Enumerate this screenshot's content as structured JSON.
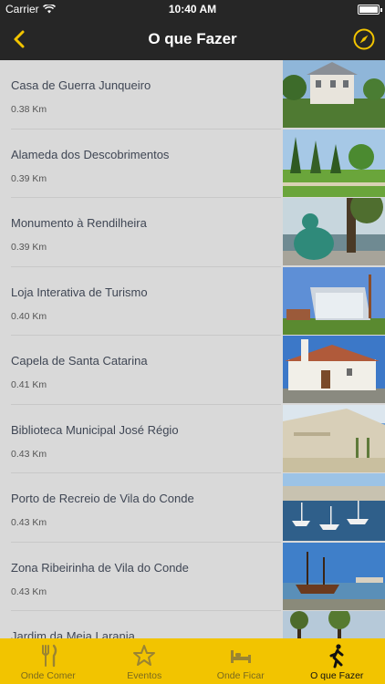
{
  "status": {
    "carrier": "Carrier",
    "time": "10:40 AM"
  },
  "nav": {
    "title": "O que Fazer",
    "back_icon": "chevron-left-icon",
    "right_icon": "compass-icon",
    "accent": "#f2c400"
  },
  "items": [
    {
      "name": "Casa de Guerra Junqueiro",
      "distance": "0.38 Km"
    },
    {
      "name": "Alameda dos Descobrimentos",
      "distance": "0.39 Km"
    },
    {
      "name": "Monumento à Rendilheira",
      "distance": "0.39 Km"
    },
    {
      "name": "Loja Interativa de Turismo",
      "distance": "0.40 Km"
    },
    {
      "name": "Capela de Santa Catarina",
      "distance": "0.41 Km"
    },
    {
      "name": "Biblioteca Municipal José Régio",
      "distance": "0.43 Km"
    },
    {
      "name": "Porto de Recreio de Vila do Conde",
      "distance": "0.43 Km"
    },
    {
      "name": "Zona Ribeirinha de Vila do Conde",
      "distance": "0.43 Km"
    },
    {
      "name": "Jardim da Meia Laranja",
      "distance": ""
    }
  ],
  "tabs": [
    {
      "label": "Onde Comer",
      "icon": "fork-knife-icon",
      "active": false
    },
    {
      "label": "Eventos",
      "icon": "star-icon",
      "active": false
    },
    {
      "label": "Onde Ficar",
      "icon": "bed-icon",
      "active": false
    },
    {
      "label": "O que Fazer",
      "icon": "walking-person-icon",
      "active": true
    }
  ]
}
